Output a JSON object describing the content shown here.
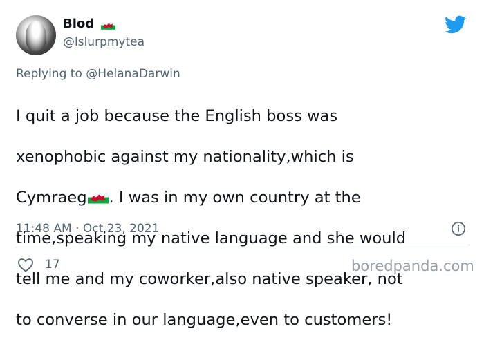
{
  "author": {
    "display_name": "Blod",
    "handle": "@lslurpmytea"
  },
  "reply_context": {
    "prefix": "Replying to",
    "mention": "@HelanaDarwin"
  },
  "tweet": {
    "lines": [
      "I quit a job because the English boss was",
      "xenophobic against my nationality,which is",
      "Cymraeg",
      ". I was in my own country at the",
      "time,speaking my native language and she would",
      "tell me and my coworker,also native speaker, not",
      "to converse in our language,even to customers!"
    ]
  },
  "timestamp": {
    "time": "11:48 AM",
    "separator": "·",
    "date": "Oct 23, 2021"
  },
  "likes": {
    "count": "17"
  },
  "watermark": "boredpanda.com",
  "icons": {
    "platform": "twitter-bird-icon",
    "flag": "welsh-flag-icon",
    "info": "info-icon",
    "like": "heart-icon"
  },
  "colors": {
    "twitter_blue": "#1d9bf0",
    "text_primary": "#0f1419",
    "text_secondary": "#536471",
    "flag_green": "#00ab39",
    "flag_red": "#d30731"
  }
}
